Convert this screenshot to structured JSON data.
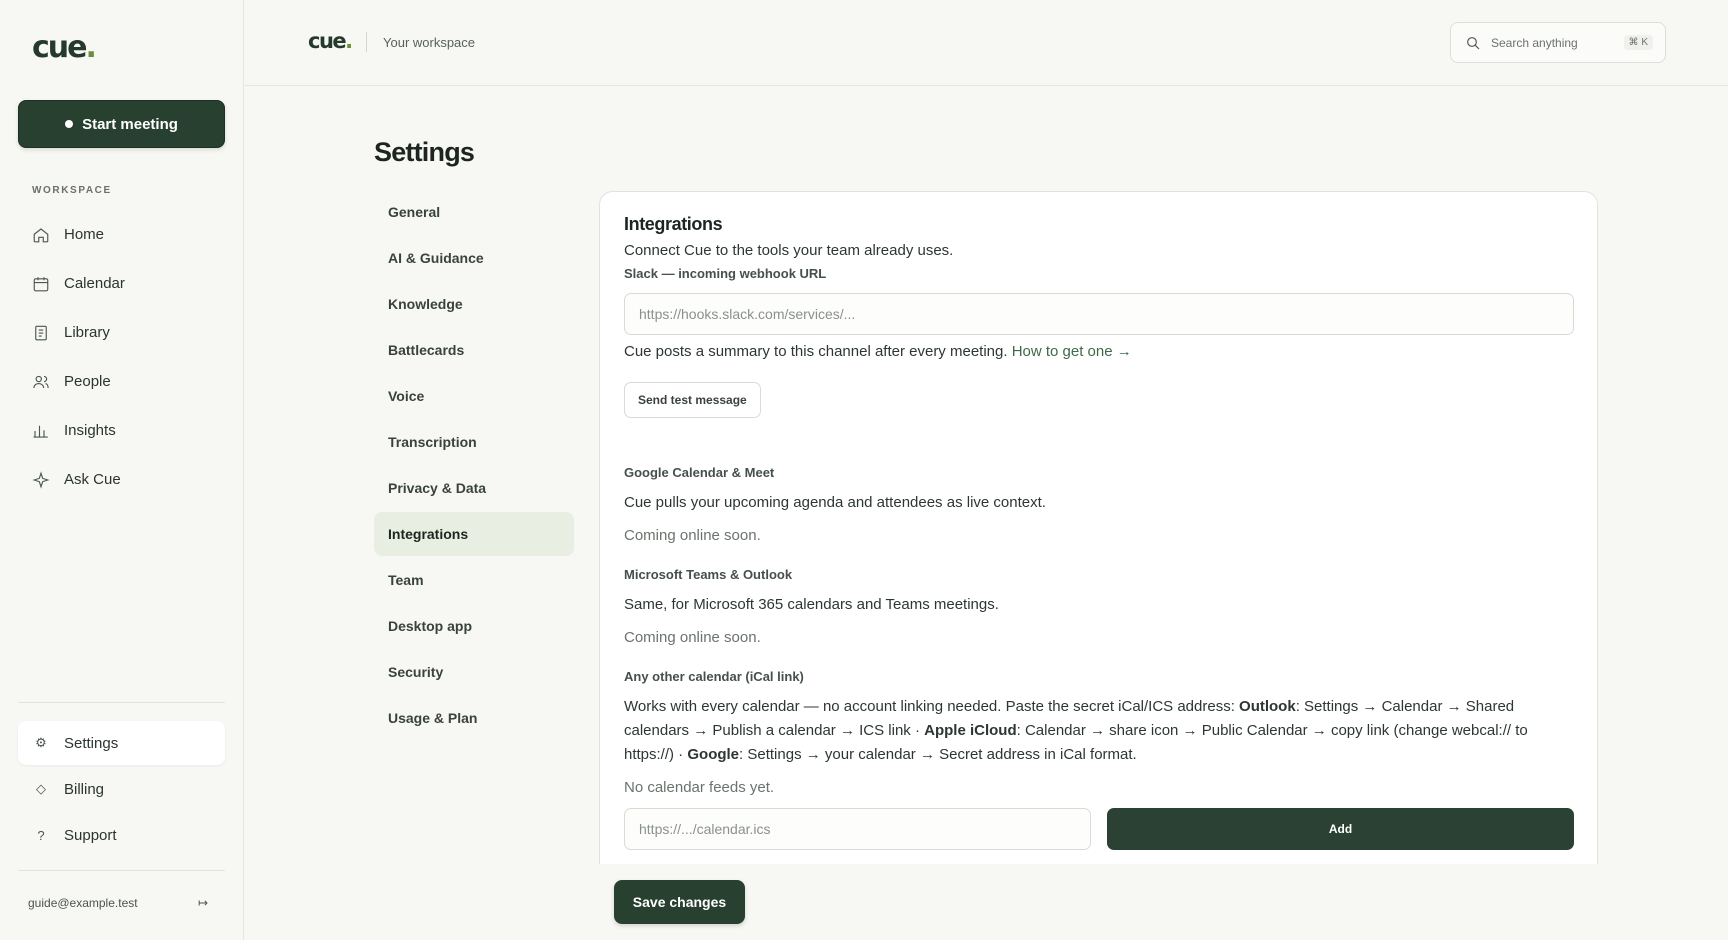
{
  "app": {
    "logo_text": "cue",
    "logo_dot": "."
  },
  "sidebar": {
    "start_button": "Start meeting",
    "section_label": "WORKSPACE",
    "items": [
      {
        "label": "Home",
        "icon": "home-icon"
      },
      {
        "label": "Calendar",
        "icon": "calendar-icon"
      },
      {
        "label": "Library",
        "icon": "library-icon"
      },
      {
        "label": "People",
        "icon": "people-icon"
      },
      {
        "label": "Insights",
        "icon": "insights-icon"
      },
      {
        "label": "Ask Cue",
        "icon": "sparkle-icon"
      }
    ],
    "bottom_items": [
      {
        "label": "Settings",
        "glyph": "⚙",
        "active": true
      },
      {
        "label": "Billing",
        "glyph": "◇"
      },
      {
        "label": "Support",
        "glyph": "?"
      }
    ],
    "user_email": "guide@example.test",
    "logout_glyph": "↦"
  },
  "topbar": {
    "workspace": "Your workspace",
    "search_placeholder": "Search anything",
    "search_shortcut": "⌘ K"
  },
  "settings": {
    "title": "Settings",
    "nav": [
      {
        "label": "General"
      },
      {
        "label": "AI & Guidance"
      },
      {
        "label": "Knowledge"
      },
      {
        "label": "Battlecards"
      },
      {
        "label": "Voice"
      },
      {
        "label": "Transcription"
      },
      {
        "label": "Privacy & Data"
      },
      {
        "label": "Integrations",
        "active": true
      },
      {
        "label": "Team"
      },
      {
        "label": "Desktop app"
      },
      {
        "label": "Security"
      },
      {
        "label": "Usage & Plan"
      }
    ],
    "save_button": "Save changes"
  },
  "integrations": {
    "title": "Integrations",
    "lead": "Connect Cue to the tools your team already uses.",
    "slack": {
      "label": "Slack — incoming webhook URL",
      "placeholder": "https://hooks.slack.com/services/...",
      "help": "Cue posts a summary to this channel after every meeting.",
      "help_link": "How to get one →",
      "test_button": "Send test message"
    },
    "google": {
      "label": "Google Calendar & Meet",
      "desc": "Cue pulls your upcoming agenda and attendees as live context.",
      "status": "Coming online soon."
    },
    "microsoft": {
      "label": "Microsoft Teams & Outlook",
      "desc": "Same, for Microsoft 365 calendars and Teams meetings.",
      "status": "Coming online soon."
    },
    "ical": {
      "label": "Any other calendar (iCal link)",
      "desc_1": "Works with every calendar — no account linking needed. Paste the secret iCal/ICS address: ",
      "outlook": "Outlook",
      "desc_2": ": Settings → Calendar → Shared calendars → Publish a calendar → ICS link · ",
      "apple": "Apple iCloud",
      "desc_3": ": Calendar → share icon → Public Calendar → copy link (change webcal:// to https://) · ",
      "google": "Google",
      "desc_4": ": Settings → your calendar → Secret address in iCal format.",
      "empty": "No calendar feeds yet.",
      "placeholder": "https://.../calendar.ics",
      "add_button": "Add"
    }
  }
}
